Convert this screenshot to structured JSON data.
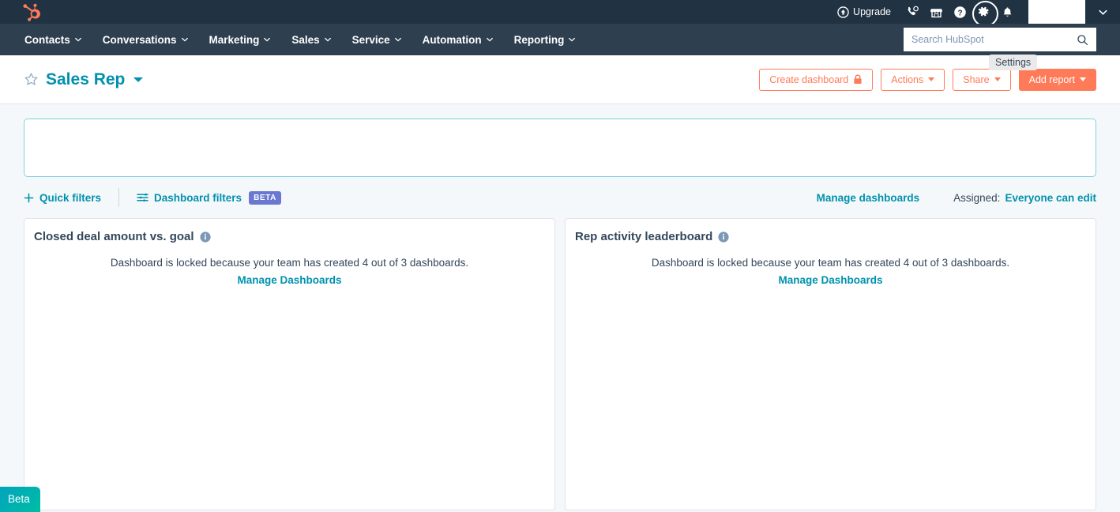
{
  "topbar": {
    "logo_icon": "hubspot-logo",
    "upgrade_label": "Upgrade",
    "upgrade_icon": "upgrade-arrow-icon",
    "icons": [
      {
        "name": "calling-icon",
        "title": "Calling"
      },
      {
        "name": "marketplace-icon",
        "title": "Marketplace"
      },
      {
        "name": "help-icon",
        "title": "Help"
      },
      {
        "name": "settings-gear-icon",
        "title": "Settings"
      },
      {
        "name": "notifications-bell-icon",
        "title": "Notifications"
      }
    ],
    "account_caret_icon": "chevron-down-icon",
    "tooltip": "Settings"
  },
  "nav": {
    "items": [
      {
        "label": "Contacts"
      },
      {
        "label": "Conversations"
      },
      {
        "label": "Marketing"
      },
      {
        "label": "Sales"
      },
      {
        "label": "Service"
      },
      {
        "label": "Automation"
      },
      {
        "label": "Reporting"
      }
    ],
    "search": {
      "placeholder": "Search HubSpot",
      "value": "",
      "icon": "search-icon"
    }
  },
  "header": {
    "star_icon": "star-outline-icon",
    "title": "Sales Rep",
    "title_caret_icon": "caret-down-icon",
    "buttons": {
      "create_dashboard": "Create dashboard",
      "create_dashboard_icon": "lock-icon",
      "actions": "Actions",
      "share": "Share",
      "add_report": "Add report"
    }
  },
  "filters": {
    "quick_filters_label": "Quick filters",
    "quick_filters_icon": "plus-icon",
    "dashboard_filters_label": "Dashboard filters",
    "dashboard_filters_icon": "sliders-icon",
    "beta_badge": "BETA",
    "manage_dashboards": "Manage dashboards",
    "assigned_label": "Assigned:",
    "assigned_value": "Everyone can edit"
  },
  "cards": [
    {
      "title": "Closed deal amount vs. goal",
      "info_icon": "info-icon",
      "locked_message": "Dashboard is locked because your team has created 4 out of 3 dashboards.",
      "manage_link": "Manage Dashboards"
    },
    {
      "title": "Rep activity leaderboard",
      "info_icon": "info-icon",
      "locked_message": "Dashboard is locked because your team has created 4 out of 3 dashboards.",
      "manage_link": "Manage Dashboards"
    }
  ],
  "beta_tab": {
    "label": "Beta"
  },
  "colors": {
    "topbar_bg": "#213343",
    "navbar_bg": "#2e3f50",
    "page_bg": "#f5f8fa",
    "accent_teal": "#0091ae",
    "accent_orange": "#ff7a59",
    "beta_purple": "#6a78d1",
    "panel_border": "#7fd1de"
  }
}
